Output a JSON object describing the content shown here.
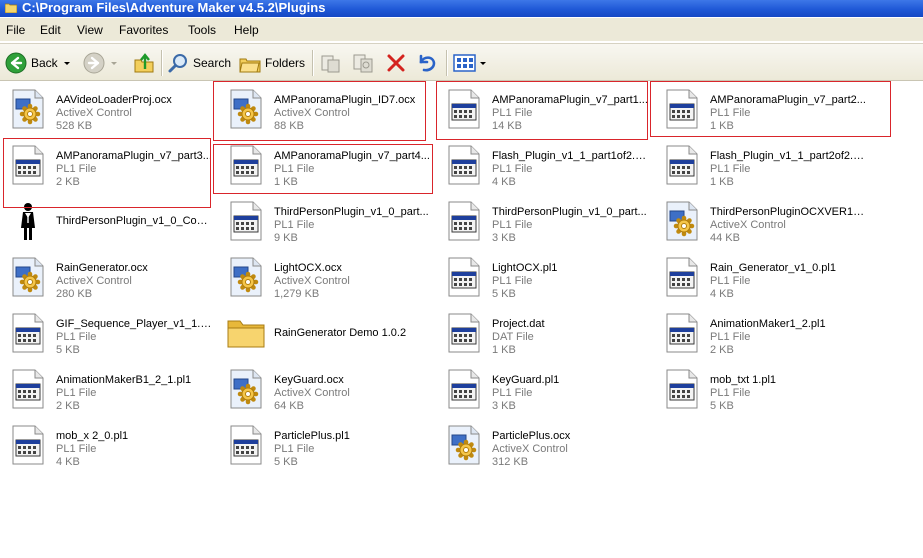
{
  "window": {
    "title": "C:\\Program Files\\Adventure Maker v4.5.2\\Plugins"
  },
  "menu": [
    "File",
    "Edit",
    "View",
    "Favorites",
    "Tools",
    "Help"
  ],
  "toolbar": {
    "back_label": "Back",
    "search_label": "Search",
    "folders_label": "Folders"
  },
  "files": [
    {
      "name": "AAVideoLoaderProj.ocx",
      "type": "ActiveX Control",
      "size": "528 KB",
      "icon": "activex-gear-icon"
    },
    {
      "name": "AMPanoramaPlugin_ID7.ocx",
      "type": "ActiveX Control",
      "size": "88 KB",
      "icon": "activex-gear-icon"
    },
    {
      "name": "AMPanoramaPlugin_v7_part1...",
      "type": "PL1 File",
      "size": "14 KB",
      "icon": "pl1-file-icon"
    },
    {
      "name": "AMPanoramaPlugin_v7_part2...",
      "type": "PL1 File",
      "size": "1 KB",
      "icon": "pl1-file-icon"
    },
    {
      "name": "AMPanoramaPlugin_v7_part3...",
      "type": "PL1 File",
      "size": "2 KB",
      "icon": "pl1-file-icon"
    },
    {
      "name": "AMPanoramaPlugin_v7_part4...",
      "type": "PL1 File",
      "size": "1 KB",
      "icon": "pl1-file-icon"
    },
    {
      "name": "Flash_Plugin_v1_1_part1of2.pl1",
      "type": "PL1 File",
      "size": "4 KB",
      "icon": "pl1-file-icon"
    },
    {
      "name": "Flash_Plugin_v1_1_part2of2.pl1",
      "type": "PL1 File",
      "size": "1 KB",
      "icon": "pl1-file-icon"
    },
    {
      "name": "ThirdPersonPlugin_v1_0_Confi...",
      "type": "",
      "size": "",
      "icon": "person-figure-icon"
    },
    {
      "name": "ThirdPersonPlugin_v1_0_part...",
      "type": "PL1 File",
      "size": "9 KB",
      "icon": "pl1-file-icon"
    },
    {
      "name": "ThirdPersonPlugin_v1_0_part...",
      "type": "PL1 File",
      "size": "3 KB",
      "icon": "pl1-file-icon"
    },
    {
      "name": "ThirdPersonPluginOCXVER1.ocx",
      "type": "ActiveX Control",
      "size": "44 KB",
      "icon": "activex-gear-icon"
    },
    {
      "name": "RainGenerator.ocx",
      "type": "ActiveX Control",
      "size": "280 KB",
      "icon": "activex-gear-icon"
    },
    {
      "name": "LightOCX.ocx",
      "type": "ActiveX Control",
      "size": "1,279 KB",
      "icon": "activex-gear-icon"
    },
    {
      "name": "LightOCX.pl1",
      "type": "PL1 File",
      "size": "5 KB",
      "icon": "pl1-file-icon"
    },
    {
      "name": "Rain_Generator_v1_0.pl1",
      "type": "PL1 File",
      "size": "4 KB",
      "icon": "pl1-file-icon"
    },
    {
      "name": "GIF_Sequence_Player_v1_1.pl1",
      "type": "PL1 File",
      "size": "5 KB",
      "icon": "pl1-file-icon"
    },
    {
      "name": "RainGenerator Demo 1.0.2",
      "type": "",
      "size": "",
      "icon": "folder-icon"
    },
    {
      "name": "Project.dat",
      "type": "DAT File",
      "size": "1 KB",
      "icon": "pl1-file-icon"
    },
    {
      "name": "AnimationMaker1_2.pl1",
      "type": "PL1 File",
      "size": "2 KB",
      "icon": "pl1-file-icon"
    },
    {
      "name": "AnimationMakerB1_2_1.pl1",
      "type": "PL1 File",
      "size": "2 KB",
      "icon": "pl1-file-icon"
    },
    {
      "name": "KeyGuard.ocx",
      "type": "ActiveX Control",
      "size": "64 KB",
      "icon": "activex-gear-icon"
    },
    {
      "name": "KeyGuard.pl1",
      "type": "PL1 File",
      "size": "3 KB",
      "icon": "pl1-file-icon"
    },
    {
      "name": "mob_txt 1.pl1",
      "type": "PL1 File",
      "size": "5 KB",
      "icon": "pl1-file-icon"
    },
    {
      "name": "mob_x 2_0.pl1",
      "type": "PL1 File",
      "size": "4 KB",
      "icon": "pl1-file-icon"
    },
    {
      "name": "ParticlePlus.pl1",
      "type": "PL1 File",
      "size": "5 KB",
      "icon": "pl1-file-icon"
    },
    {
      "name": "ParticlePlus.ocx",
      "type": "ActiveX Control",
      "size": "312 KB",
      "icon": "activex-gear-icon"
    }
  ],
  "highlighted_files": [
    1,
    2,
    3,
    4,
    5
  ],
  "colors": {
    "titlebar": "#1f58d6",
    "highlight_box": "#d9252b",
    "secondary_text": "#7a7a7a"
  }
}
